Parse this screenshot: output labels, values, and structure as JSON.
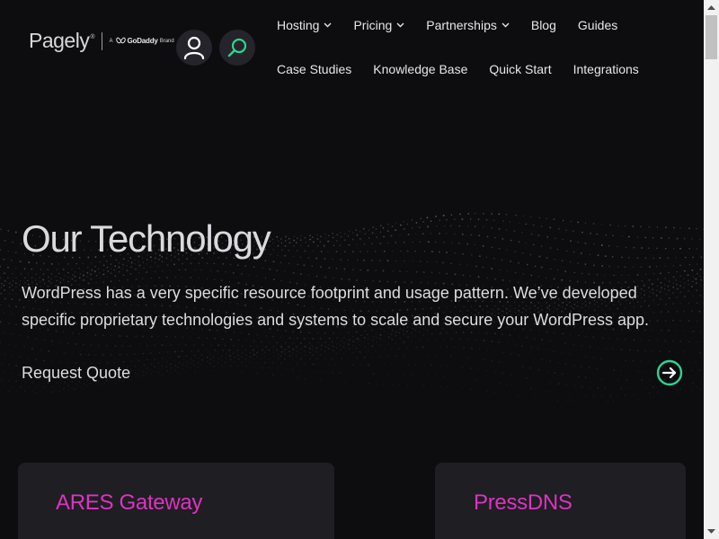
{
  "header": {
    "logo": {
      "wordmark": "Pagely",
      "registered": "®",
      "brand_prefix": "A",
      "brand_name": "GoDaddy",
      "brand_suffix": "Brand"
    },
    "account_icon": "user-icon",
    "search_icon": "search-icon",
    "nav": {
      "row1": [
        {
          "label": "Hosting",
          "has_dropdown": true
        },
        {
          "label": "Pricing",
          "has_dropdown": true
        },
        {
          "label": "Partnerships",
          "has_dropdown": true
        },
        {
          "label": "Blog",
          "has_dropdown": false
        },
        {
          "label": "Guides",
          "has_dropdown": false
        }
      ],
      "row2": [
        {
          "label": "Case Studies"
        },
        {
          "label": "Knowledge Base"
        },
        {
          "label": "Quick Start"
        },
        {
          "label": "Integrations"
        }
      ]
    }
  },
  "hero": {
    "title": "Our Technology",
    "description": "WordPress has a very specific resource footprint and usage pattern. We’ve developed specific proprietary technologies and systems to scale and secure your WordPress app.",
    "cta_label": "Request Quote",
    "cta_icon": "arrow-right-circle-icon"
  },
  "cards": [
    {
      "title": "ARES Gateway"
    },
    {
      "title": "PressDNS"
    }
  ],
  "colors": {
    "background": "#0d0d10",
    "accent_green": "#2fd48c",
    "card_title_magenta": "#dd33c0",
    "card_background": "#1e1e23",
    "icon_button_bg": "#24242a"
  }
}
